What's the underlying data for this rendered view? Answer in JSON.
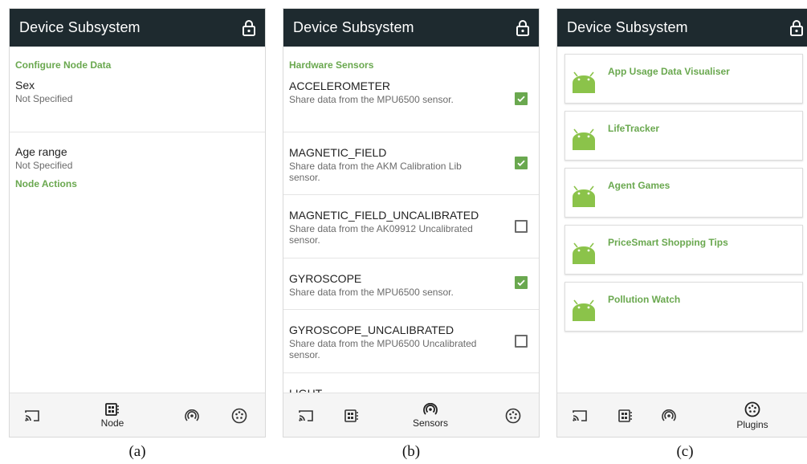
{
  "colors": {
    "appbar": "#1e2a2f",
    "accent": "#6aa84f",
    "check": "#6aa84f"
  },
  "app_title": "Device Subsystem",
  "screen_a": {
    "section1": "Configure Node Data",
    "prefs": [
      {
        "title": "Sex",
        "summary": "Not Specified"
      },
      {
        "title": "Age range",
        "summary": "Not Specified"
      }
    ],
    "section2": "Node Actions",
    "nav_label": "Node",
    "caption": "(a)"
  },
  "screen_b": {
    "section": "Hardware Sensors",
    "sensors": [
      {
        "title": "ACCELEROMETER",
        "summary": "Share data from the MPU6500 sensor.",
        "checked": true
      },
      {
        "title": "MAGNETIC_FIELD",
        "summary": "Share data from the AKM Calibration Lib sensor.",
        "checked": true
      },
      {
        "title": "MAGNETIC_FIELD_UNCALIBRATED",
        "summary": "Share data from the AK09912 Uncalibrated sensor.",
        "checked": false
      },
      {
        "title": "GYROSCOPE",
        "summary": "Share data from the MPU6500 sensor.",
        "checked": true
      },
      {
        "title": "GYROSCOPE_UNCALIBRATED",
        "summary": "Share data from the MPU6500 Uncalibrated sensor.",
        "checked": false
      },
      {
        "title": "LIGHT",
        "summary": "",
        "checked": false
      }
    ],
    "nav_label": "Sensors",
    "caption": "(b)"
  },
  "screen_c": {
    "plugins": [
      "App Usage Data Visualiser",
      "LifeTracker",
      "Agent Games",
      "PriceSmart Shopping Tips",
      "Pollution Watch"
    ],
    "nav_label": "Plugins",
    "caption": "(c)"
  },
  "icons": {
    "lock": "lock-icon",
    "cast": "cast-icon",
    "node": "node-icon",
    "sensors": "sensors-icon",
    "plugins": "plugins-icon",
    "android": "android-icon",
    "checkbox": "checkbox-icon"
  }
}
